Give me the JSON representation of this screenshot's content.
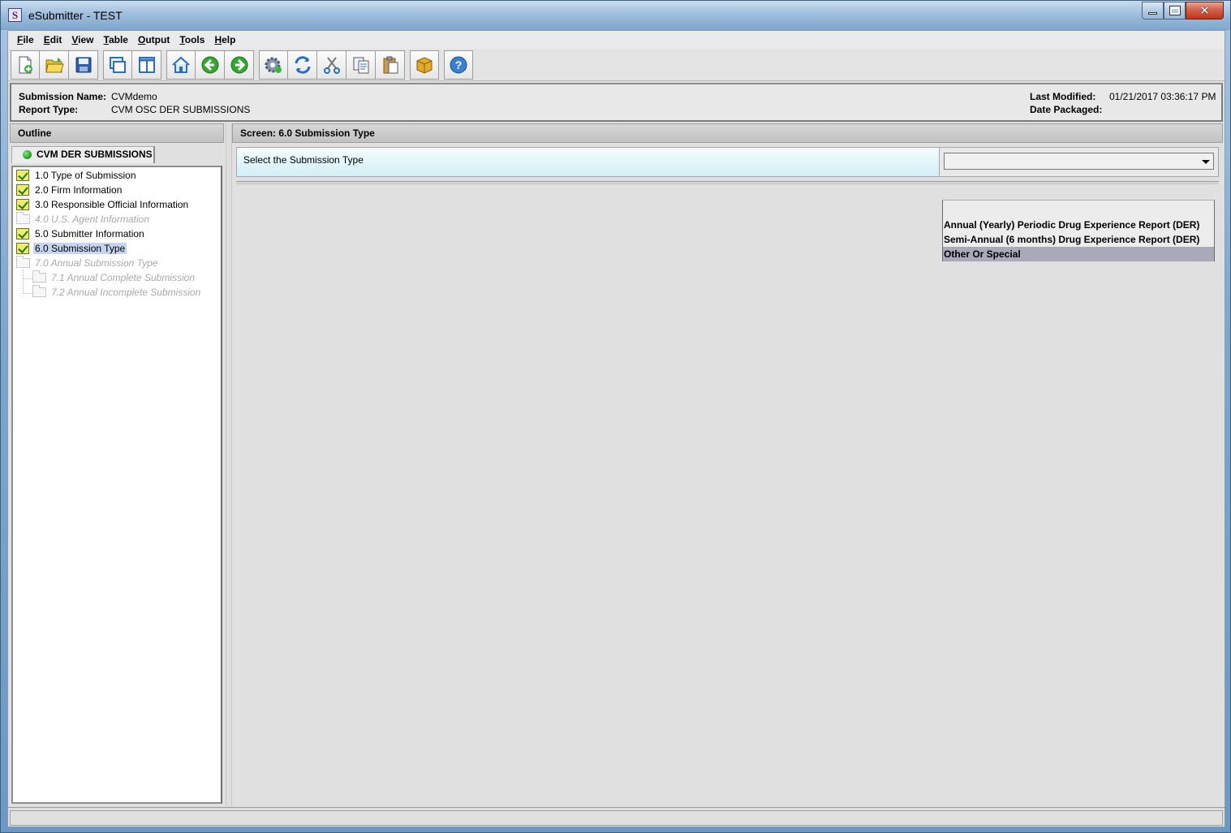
{
  "window": {
    "title": "eSubmitter - TEST",
    "app_icon_letter": "S"
  },
  "menu": [
    {
      "mnemonic": "F",
      "rest": "ile"
    },
    {
      "mnemonic": "E",
      "rest": "dit"
    },
    {
      "mnemonic": "V",
      "rest": "iew"
    },
    {
      "mnemonic": "T",
      "rest": "able",
      "pre": ""
    },
    {
      "mnemonic": "O",
      "rest": "utput"
    },
    {
      "mnemonic": "T",
      "rest": "ools"
    },
    {
      "mnemonic": "H",
      "rest": "elp"
    }
  ],
  "toolbar_icons": [
    "new-document-icon",
    "open-folder-icon",
    "save-icon",
    "cascade-windows-icon",
    "split-view-icon",
    "home-icon",
    "back-arrow-icon",
    "forward-arrow-icon",
    "settings-gear-icon",
    "refresh-icon",
    "cut-icon",
    "copy-icon",
    "paste-icon",
    "package-icon",
    "help-icon"
  ],
  "info": {
    "submission_name_label": "Submission Name:",
    "submission_name": "CVMdemo",
    "report_type_label": "Report Type:",
    "report_type": "CVM OSC DER SUBMISSIONS",
    "last_modified_label": "Last Modified:",
    "last_modified": "01/21/2017 03:36:17 PM",
    "date_packaged_label": "Date Packaged:",
    "date_packaged": ""
  },
  "outline": {
    "header": "Outline",
    "tab_label": "CVM DER SUBMISSIONS",
    "items": [
      {
        "label": "1.0 Type of Submission",
        "state": "complete"
      },
      {
        "label": "2.0 Firm Information",
        "state": "complete"
      },
      {
        "label": "3.0 Responsible Official Information",
        "state": "complete"
      },
      {
        "label": "4.0 U.S. Agent Information",
        "state": "disabled"
      },
      {
        "label": "5.0 Submitter Information",
        "state": "complete"
      },
      {
        "label": "6.0 Submission Type",
        "state": "complete-selected"
      },
      {
        "label": "7.0 Annual Submission Type",
        "state": "disabled"
      },
      {
        "label": "7.1 Annual Complete Submission",
        "state": "disabled"
      },
      {
        "label": "7.2 Annual Incomplete Submission",
        "state": "disabled"
      }
    ]
  },
  "screen": {
    "header": "Screen: 6.0 Submission Type",
    "question": "Select the Submission Type",
    "selected_value": "",
    "options": [
      "Annual (Yearly) Periodic Drug Experience Report (DER)",
      "Semi-Annual (6 months) Drug Experience Report (DER)",
      "Other Or Special"
    ],
    "highlighted_option": "Other Or Special"
  },
  "status": {
    "text": ""
  }
}
